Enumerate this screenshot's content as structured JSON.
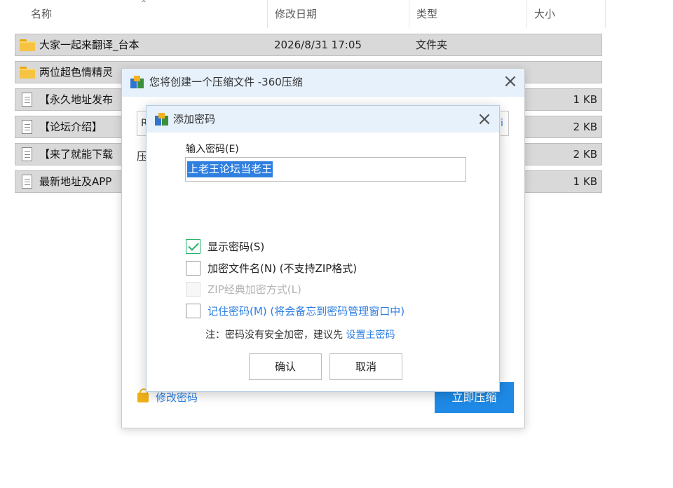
{
  "explorer": {
    "columns": {
      "name": "名称",
      "date": "修改日期",
      "type": "类型",
      "size": "大小"
    },
    "rows": [
      {
        "name": "大家一起来翻译_台本",
        "date": "2026/8/31 17:05",
        "type": "文件夹",
        "size": "",
        "icon": "folder-icon"
      },
      {
        "name": "两位超色情精灵",
        "date": "",
        "type": "",
        "size": "",
        "icon": "folder-icon"
      },
      {
        "name": "【永久地址发布",
        "date": "",
        "type": "",
        "size": "1 KB",
        "icon": "document-icon"
      },
      {
        "name": "【论坛介绍】",
        "date": "",
        "type": "",
        "size": "2 KB",
        "icon": "document-icon"
      },
      {
        "name": "【来了就能下载",
        "date": "",
        "type": "",
        "size": "2 KB",
        "icon": "document-icon"
      },
      {
        "name": "最新地址及APP",
        "date": "",
        "type": "",
        "size": "1 KB",
        "icon": "document-icon"
      }
    ]
  },
  "compress_window": {
    "title": "您将创建一个压缩文件 -360压缩",
    "close": "×",
    "field_prefix": "R",
    "field_suffix": "i",
    "row_label": "压",
    "change_password_link": "修改密码",
    "compress_button": "立即压缩"
  },
  "password_dialog": {
    "title": "添加密码",
    "close": "×",
    "password_label": "输入密码(E)",
    "password_value": "上老王论坛当老王",
    "options": {
      "show_password": {
        "label": "显示密码(S)",
        "checked": true
      },
      "encrypt_filenames": {
        "label": "加密文件名(N) (不支持ZIP格式)",
        "checked": false
      },
      "zip_classic": {
        "label": "ZIP经典加密方式(L)",
        "checked": false,
        "disabled": true
      },
      "remember_password": {
        "label": "记住密码(M) (将会备忘到密码管理窗口中)",
        "checked": false
      }
    },
    "note_prefix": "注：密码没有安全加密，建议先",
    "note_link": "设置主密码",
    "ok_button": "确认",
    "cancel_button": "取消"
  },
  "colors": {
    "accent": "#1e8ae6",
    "link": "#2b7de1",
    "check": "#27b36a",
    "titlebar": "#e7f1fb",
    "row_selected": "#d9d9d9"
  }
}
